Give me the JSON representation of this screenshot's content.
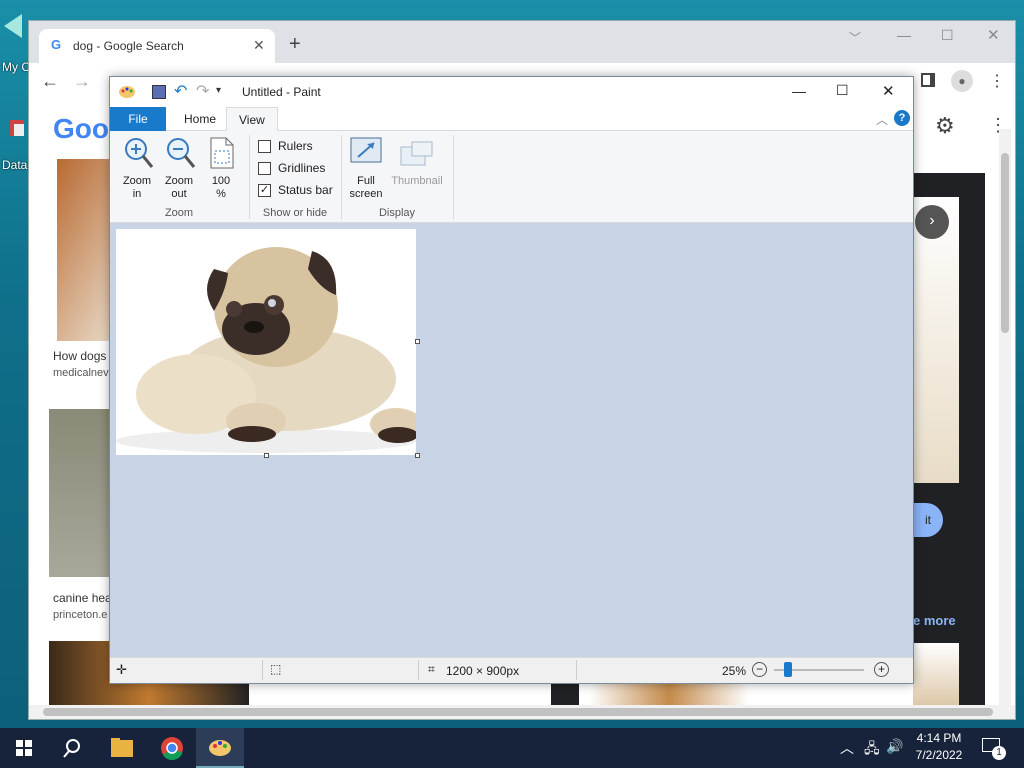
{
  "desktop": {
    "icons": [
      {
        "label": "My C"
      },
      {
        "label": "Data"
      }
    ]
  },
  "chrome": {
    "tab_title": "dog - Google Search",
    "new_tab": "+",
    "logo_text": "Goo",
    "results": [
      {
        "title": "How dogs",
        "source": "medicalnev"
      },
      {
        "title": "canine hea",
        "source": "princeton.e"
      }
    ],
    "right_panel": {
      "visit_label": "it",
      "more_label": "e more"
    }
  },
  "paint": {
    "title": "Untitled - Paint",
    "tabs": {
      "file": "File",
      "home": "Home",
      "view": "View"
    },
    "ribbon": {
      "zoom_in": [
        "Zoom",
        "in"
      ],
      "zoom_out": [
        "Zoom",
        "out"
      ],
      "hundred": [
        "100",
        "%"
      ],
      "zoom_group": "Zoom",
      "rulers": "Rulers",
      "gridlines": "Gridlines",
      "statusbar": "Status bar",
      "show_group": "Show or hide",
      "fullscreen": [
        "Full",
        "screen"
      ],
      "thumbnail": "Thumbnail",
      "display_group": "Display"
    },
    "checks": {
      "rulers": false,
      "gridlines": false,
      "statusbar": true
    },
    "status": {
      "dimensions": "1200 × 900px",
      "zoom": "25%",
      "zoom_level": 0.25
    }
  },
  "taskbar": {
    "time": "4:14 PM",
    "date": "7/2/2022",
    "notifications": "1"
  },
  "colors": {
    "file_tab": "#1979ca",
    "taskbar": "#16233a",
    "canvas_bg": "#c8d3e5",
    "help": "#1979ca"
  }
}
